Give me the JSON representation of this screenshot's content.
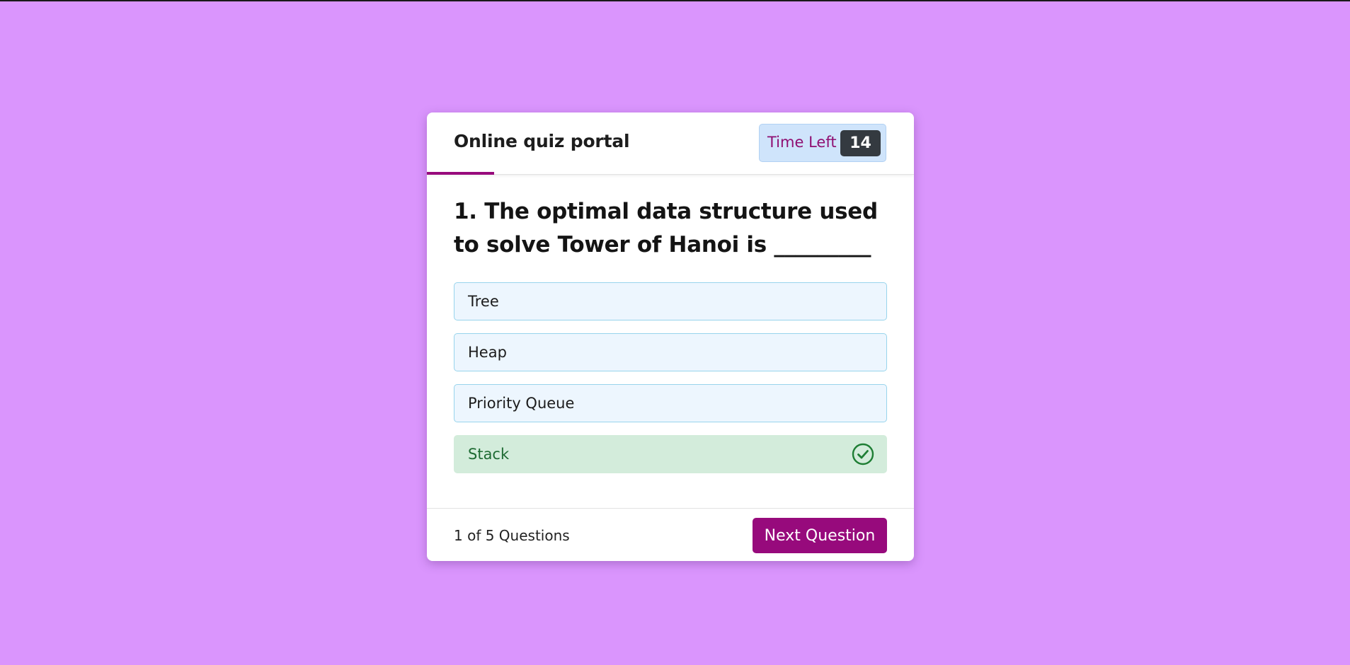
{
  "header": {
    "title": "Online quiz portal",
    "timer_label": "Time Left",
    "timer_value": "14"
  },
  "question": {
    "text": "1. The optimal data structure used to solve Tower of Hanoi is _________"
  },
  "options": [
    {
      "label": "Tree",
      "state": "default"
    },
    {
      "label": "Heap",
      "state": "default"
    },
    {
      "label": "Priority Queue",
      "state": "default"
    },
    {
      "label": "Stack",
      "state": "correct",
      "icon": "check-circle-icon"
    }
  ],
  "footer": {
    "count_text": "1 of 5 Questions",
    "next_label": "Next Question"
  },
  "colors": {
    "background": "#da95fd",
    "accent": "#970a7c",
    "correct": "#1e7e34",
    "timer_badge": "#343a40"
  }
}
